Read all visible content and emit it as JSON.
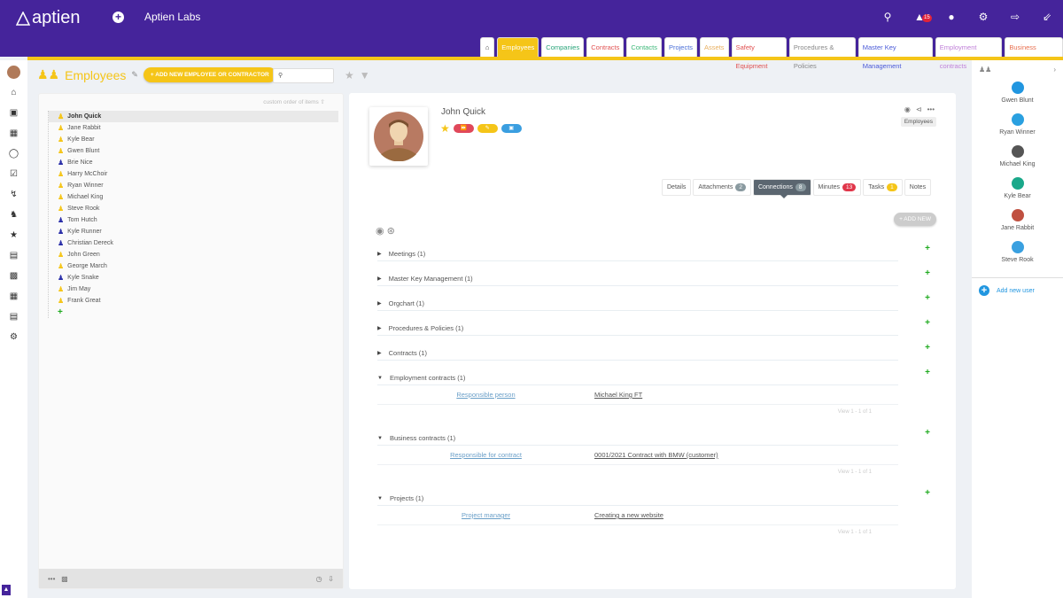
{
  "app": {
    "logo": "aptien",
    "org": "Aptien Labs"
  },
  "top_icons": [
    "search-icon",
    "bell-icon",
    "chat-icon",
    "gear-icon",
    "logout-icon",
    "compress-icon"
  ],
  "notifications": "15",
  "tabs": [
    {
      "label": "Employees",
      "color": "#ffffff",
      "active": true
    },
    {
      "label": "Companies",
      "color": "#2aa57a"
    },
    {
      "label": "Contracts",
      "color": "#e05050"
    },
    {
      "label": "Contacts",
      "color": "#3cb878"
    },
    {
      "label": "Projects",
      "color": "#4a6fd8"
    },
    {
      "label": "Assets",
      "color": "#e8b060"
    },
    {
      "label": "Safety Equipment",
      "color": "#e05050"
    },
    {
      "label": "Procedures & Policies",
      "color": "#888888"
    },
    {
      "label": "Master Key Management",
      "color": "#4a5ad8"
    },
    {
      "label": "Employment contracts",
      "color": "#c080d8"
    },
    {
      "label": "Business contracts",
      "color": "#e87050"
    }
  ],
  "header": {
    "title": "Employees",
    "add_button": "+ ADD NEW EMPLOYEE OR CONTRACTOR",
    "search_placeholder": ""
  },
  "list": {
    "order_label": "custom order of items",
    "items": [
      {
        "name": "John Quick",
        "c": "y"
      },
      {
        "name": "Jane Rabbit",
        "c": "y"
      },
      {
        "name": "Kyle Bear",
        "c": "y"
      },
      {
        "name": "Gwen Blunt",
        "c": "y"
      },
      {
        "name": "Brie Nice",
        "c": "b"
      },
      {
        "name": "Harry McChoir",
        "c": "y"
      },
      {
        "name": "Ryan Winner",
        "c": "y"
      },
      {
        "name": "Michael King",
        "c": "y"
      },
      {
        "name": "Steve Rook",
        "c": "y"
      },
      {
        "name": "Tom Hutch",
        "c": "b"
      },
      {
        "name": "Kyle Runner",
        "c": "b"
      },
      {
        "name": "Christian Dereck",
        "c": "b"
      },
      {
        "name": "John Green",
        "c": "y"
      },
      {
        "name": "George March",
        "c": "y"
      },
      {
        "name": "Kyle Snake",
        "c": "b"
      },
      {
        "name": "Jim May",
        "c": "y"
      },
      {
        "name": "Frank Great",
        "c": "y"
      }
    ]
  },
  "detail": {
    "name": "John Quick",
    "tag": "Employees",
    "add_new": "+ ADD NEW",
    "tabs": [
      {
        "label": "Details"
      },
      {
        "label": "Attachments",
        "badge": "2",
        "bc": "#8a9aa0"
      },
      {
        "label": "Connections",
        "badge": "8",
        "bc": "#8a9aa0",
        "active": true
      },
      {
        "label": "Minutes",
        "badge": "13",
        "bc": "#e0364a"
      },
      {
        "label": "Tasks",
        "badge": "1",
        "bc": "#f5c518"
      },
      {
        "label": "Notes"
      }
    ],
    "sections": [
      {
        "title": "Meetings (1)",
        "open": false
      },
      {
        "title": "Master Key Management (1)",
        "open": false
      },
      {
        "title": "Orgchart (1)",
        "open": false
      },
      {
        "title": "Procedures & Policies (1)",
        "open": false
      },
      {
        "title": "Contracts (1)",
        "open": false
      },
      {
        "title": "Employment contracts (1)",
        "open": true,
        "role": "Responsible person",
        "value": "Michael King FT",
        "view": "View 1 - 1 of 1"
      },
      {
        "title": "Business contracts (1)",
        "open": true,
        "role": "Responsible for contract",
        "value": "0001/2021 Contract with BMW (customer)",
        "view": "View 1 - 1 of 1"
      },
      {
        "title": "Projects (1)",
        "open": true,
        "role": "Project manager",
        "value": "Creating a new website",
        "view": "View 1 - 1 of 1"
      }
    ]
  },
  "users": [
    {
      "name": "Gwen Blunt",
      "c": "#2196e0"
    },
    {
      "name": "Ryan Winner",
      "c": "#2aa0e0"
    },
    {
      "name": "Michael King",
      "c": "#555"
    },
    {
      "name": "Kyle Bear",
      "c": "#1aa88a"
    },
    {
      "name": "Jane Rabbit",
      "c": "#c05040"
    },
    {
      "name": "Steve Rook",
      "c": "#3aa0e0"
    }
  ],
  "add_user": "Add new user"
}
